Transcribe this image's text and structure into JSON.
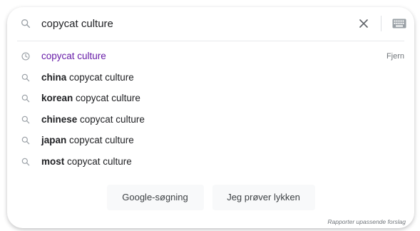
{
  "search": {
    "value": "copycat culture"
  },
  "icons": {
    "search": "search-icon",
    "clear": "close-icon",
    "keyboard": "keyboard-icon",
    "history": "clock-icon"
  },
  "suggestions": [
    {
      "type": "history",
      "bold": "",
      "rest": "copycat culture",
      "remove_label": "Fjern"
    },
    {
      "type": "search",
      "bold": "china",
      "rest": " copycat culture"
    },
    {
      "type": "search",
      "bold": "korean",
      "rest": " copycat culture"
    },
    {
      "type": "search",
      "bold": "chinese",
      "rest": " copycat culture"
    },
    {
      "type": "search",
      "bold": "japan",
      "rest": " copycat culture"
    },
    {
      "type": "search",
      "bold": "most",
      "rest": " copycat culture"
    }
  ],
  "buttons": {
    "search_label": "Google-søgning",
    "lucky_label": "Jeg prøver lykken"
  },
  "footer": {
    "report_label": "Rapporter upassende forslag"
  },
  "colors": {
    "history_text": "#681da8",
    "text": "#202124",
    "muted": "#70757a",
    "button_bg": "#f8f9fa"
  }
}
